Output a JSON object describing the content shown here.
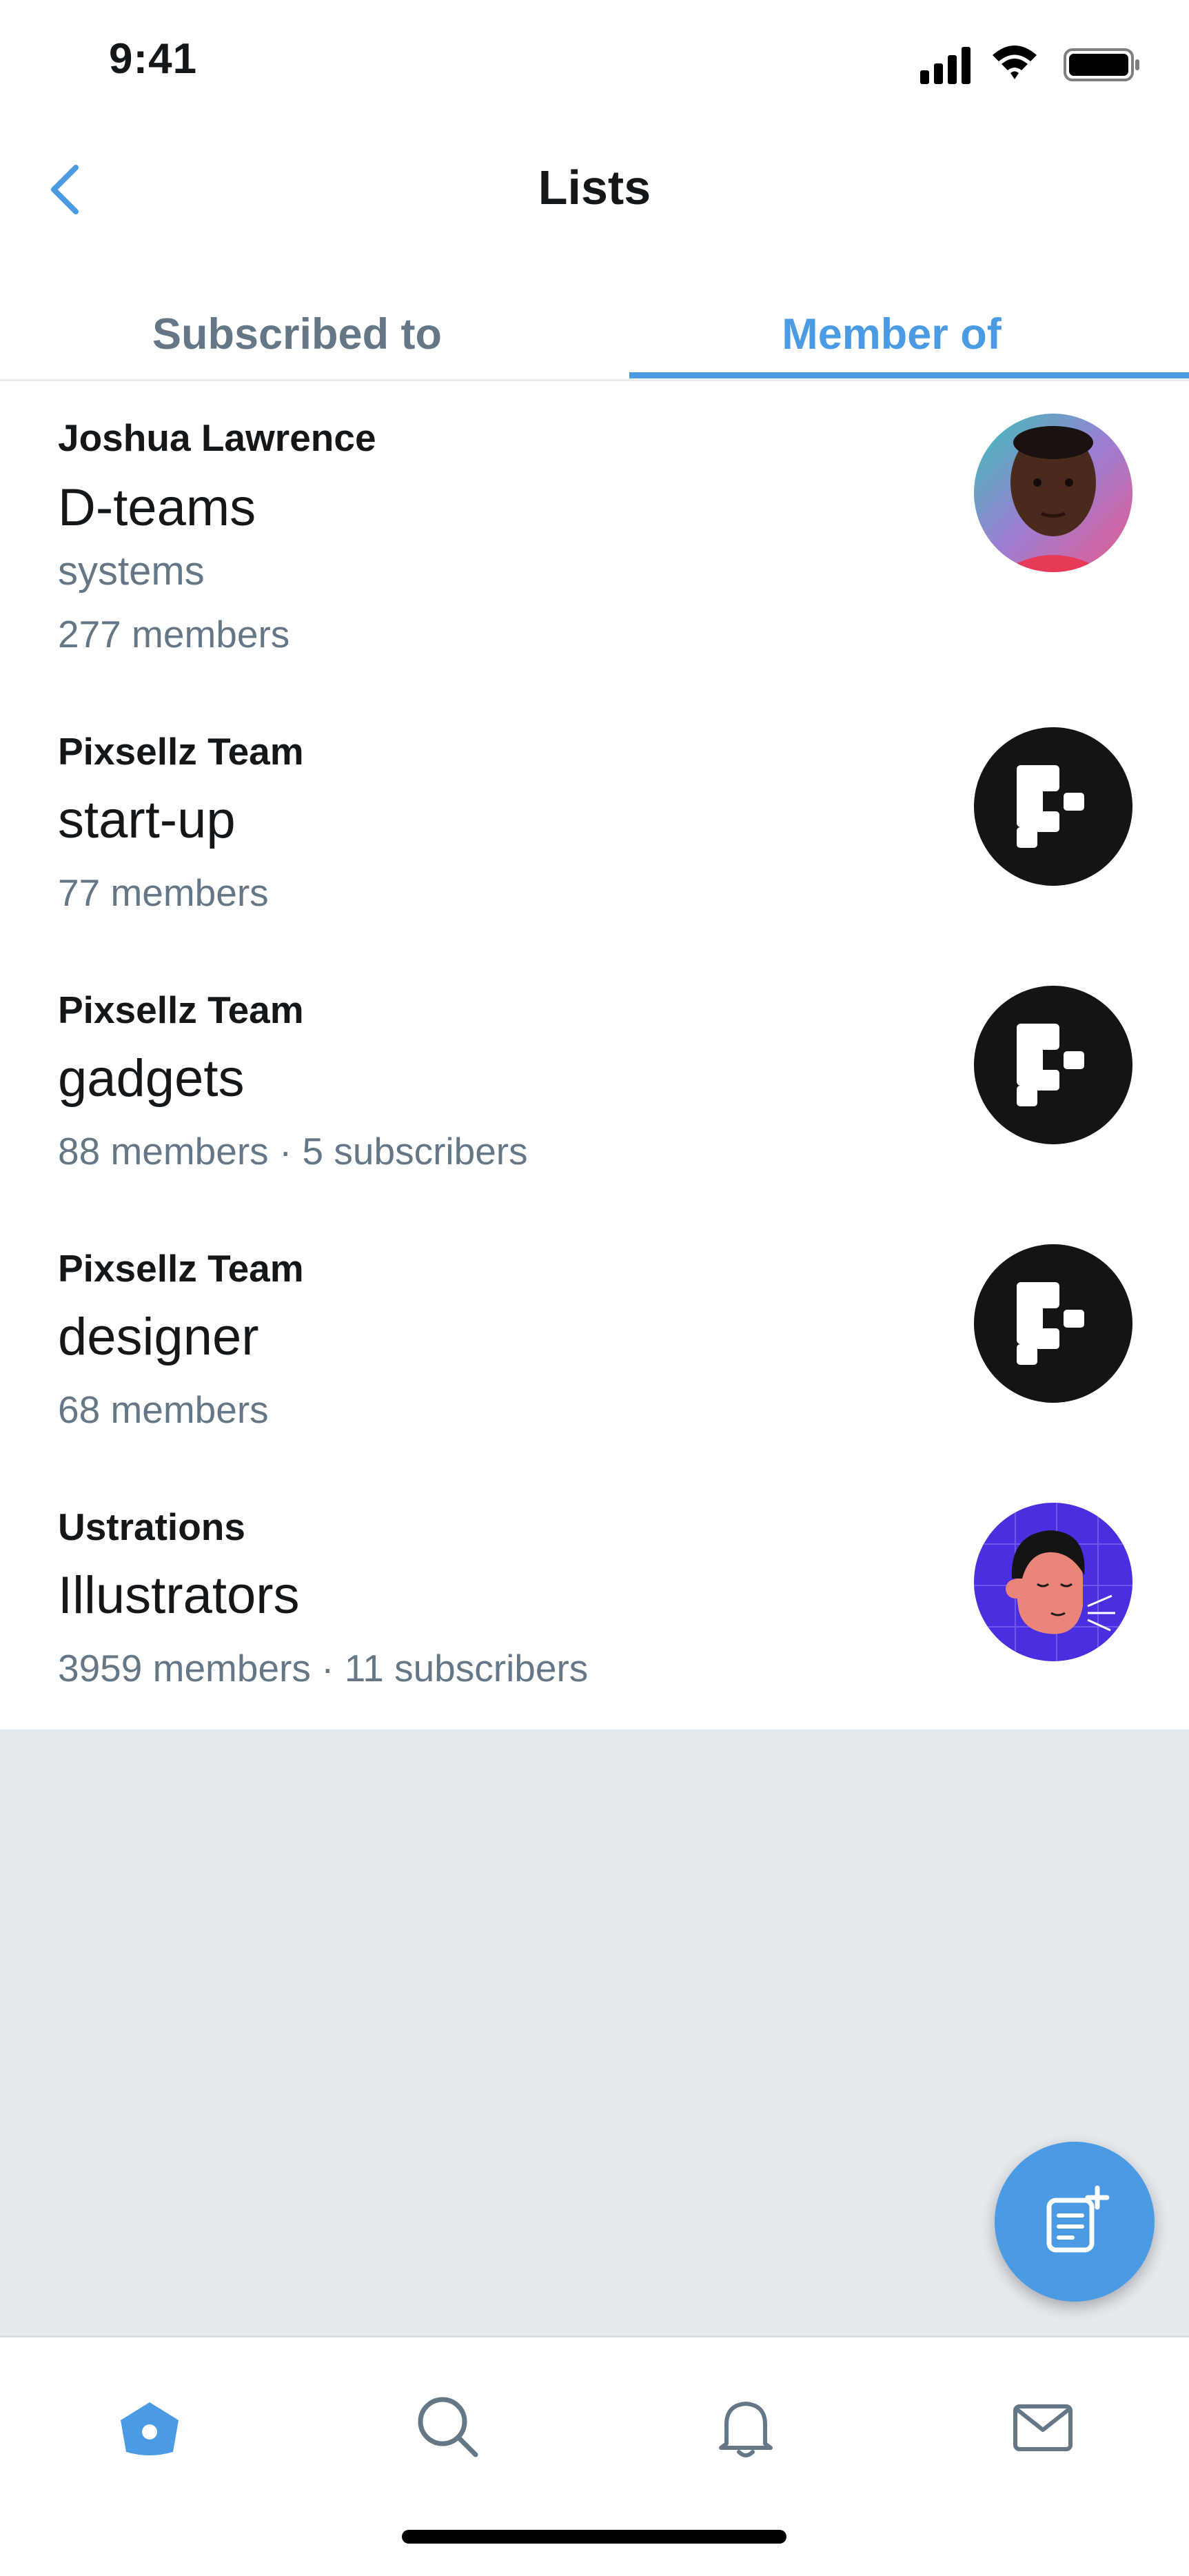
{
  "status_bar": {
    "time": "9:41"
  },
  "header": {
    "title": "Lists"
  },
  "tabs": [
    {
      "label": "Subscribed to",
      "active": false
    },
    {
      "label": "Member of",
      "active": true
    }
  ],
  "lists": [
    {
      "owner": "Joshua Lawrence",
      "name": "D-teams",
      "description": "systems",
      "meta": "277 members",
      "avatar": "person-photo-avatar"
    },
    {
      "owner": "Pixsellz Team",
      "name": "start-up",
      "meta": "77 members",
      "avatar": "pixsellz-logo-avatar"
    },
    {
      "owner": "Pixsellz Team",
      "name": "gadgets",
      "meta": "88 members · 5 subscribers",
      "avatar": "pixsellz-logo-avatar"
    },
    {
      "owner": "Pixsellz Team",
      "name": "designer",
      "meta": "68 members",
      "avatar": "pixsellz-logo-avatar"
    },
    {
      "owner": "Ustrations",
      "name": "Illustrators",
      "meta": "3959 members · 11 subscribers",
      "avatar": "illustrated-face-avatar"
    }
  ],
  "fab": {
    "icon": "compose-list-icon"
  },
  "bottom_nav": [
    {
      "icon": "home-icon",
      "active": true
    },
    {
      "icon": "search-icon",
      "active": false
    },
    {
      "icon": "notifications-bell-icon",
      "active": false
    },
    {
      "icon": "messages-mail-icon",
      "active": false
    }
  ],
  "colors": {
    "accent": "#4a9be4",
    "secondary_text": "#657786",
    "empty_background": "#e6e9ee"
  }
}
